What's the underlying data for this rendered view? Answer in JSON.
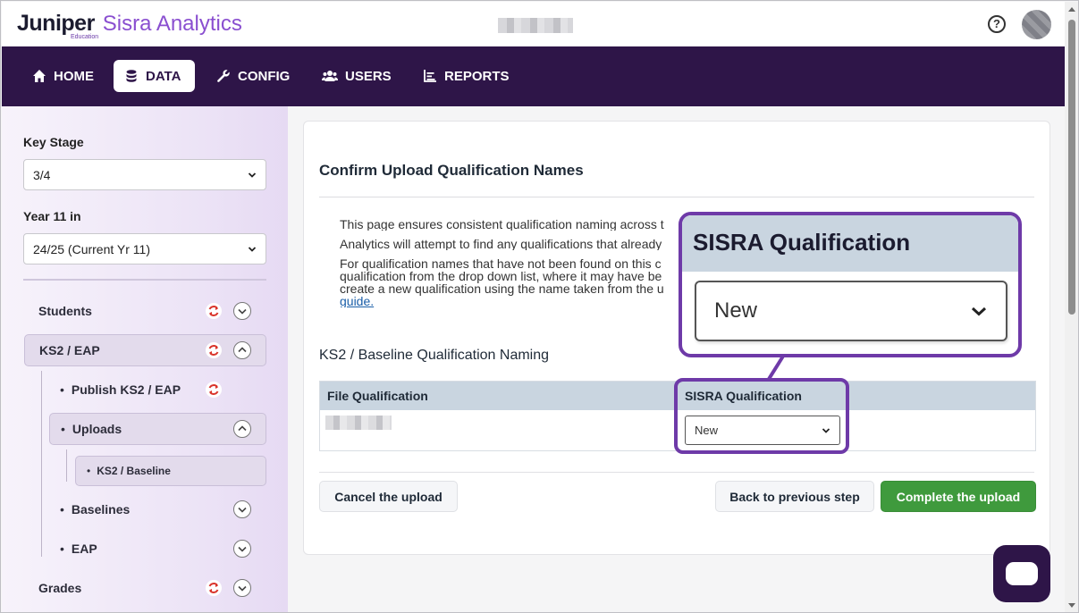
{
  "header": {
    "brand": "Juniper",
    "brand_sub": "Education",
    "product": "Sisra Analytics",
    "help_icon": "help-circle-icon",
    "avatar_icon": "user-avatar"
  },
  "nav": {
    "items": [
      {
        "label": "HOME",
        "icon": "home-icon"
      },
      {
        "label": "DATA",
        "icon": "database-icon",
        "active": true
      },
      {
        "label": "CONFIG",
        "icon": "wrench-icon"
      },
      {
        "label": "USERS",
        "icon": "users-icon"
      },
      {
        "label": "REPORTS",
        "icon": "chart-icon"
      }
    ]
  },
  "sidebar": {
    "key_stage_label": "Key Stage",
    "key_stage_value": "3/4",
    "year_label": "Year 11 in",
    "year_value": "24/25 (Current Yr 11)",
    "tree": {
      "students": "Students",
      "ks2": "KS2 / EAP",
      "publish": "Publish KS2 / EAP",
      "uploads": "Uploads",
      "ks2_baseline": "KS2 / Baseline",
      "baselines": "Baselines",
      "eap": "EAP",
      "grades": "Grades"
    }
  },
  "main": {
    "title": "Confirm Upload Qualification Names",
    "bullets": [
      "This page ensures consistent qualification naming across t",
      "Analytics will attempt to find any qualifications that already",
      "For qualification names that have not been found on this c"
    ],
    "bullet3_line2": "qualification from the drop down list, where it may have be",
    "bullet3_line3": "create a new qualification using the name taken from the u",
    "bullet3_link": "guide.",
    "section_title": "KS2 / Baseline  Qualification Naming",
    "table": {
      "col_file": "File Qualification",
      "col_sisra": "SISRA Qualification",
      "row_select_value": "New"
    },
    "buttons": {
      "cancel": "Cancel the upload",
      "back": "Back to previous step",
      "complete": "Complete the upload"
    }
  },
  "callout": {
    "title": "SISRA Qualification",
    "select_value": "New"
  },
  "colors": {
    "nav_bg": "#2e1548",
    "brand_purple": "#8a4fd0",
    "highlight": "#6e3aa8",
    "complete_green": "#3f9a3d",
    "table_header": "#c9d5e0"
  }
}
